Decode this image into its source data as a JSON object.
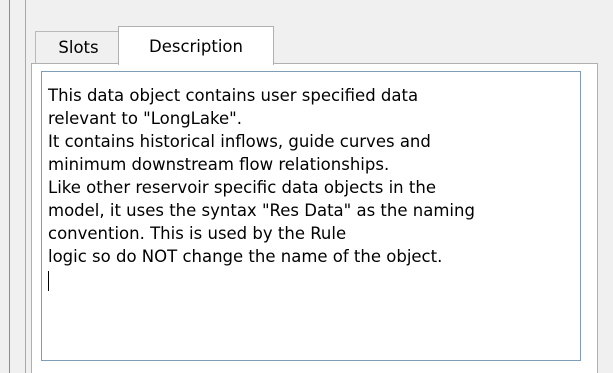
{
  "tabs": [
    {
      "label": "Slots",
      "selected": false
    },
    {
      "label": "Description",
      "selected": true
    }
  ],
  "description": {
    "lines": [
      "This data object contains user specified data",
      "relevant to \"LongLake\".",
      "It contains historical inflows, guide curves and",
      "minimum downstream flow relationships.",
      "Like other reservoir specific data objects in the",
      "model, it uses the syntax \"Res Data\" as the naming",
      "convention. This is used by the Rule",
      "logic so do NOT change the name of the object."
    ]
  }
}
